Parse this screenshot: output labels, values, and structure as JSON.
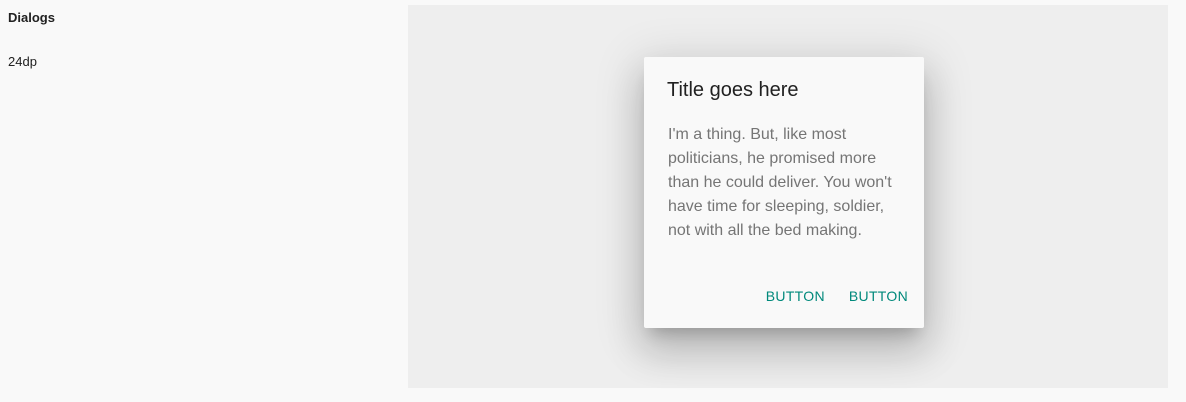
{
  "sidebar": {
    "heading": "Dialogs",
    "elevation": "24dp"
  },
  "dialog": {
    "title": "Title goes here",
    "body": "I'm a thing. But, like most politicians, he promised more than he could deliver. You won't have time for sleeping, soldier, not with all the bed making.",
    "actions": [
      {
        "label": "BUTTON"
      },
      {
        "label": "BUTTON"
      }
    ]
  },
  "colors": {
    "page_background": "#f9f9f9",
    "stage_background": "#eeeeee",
    "dialog_background": "#f9f9f9",
    "accent": "#00897b",
    "title_text": "#212121",
    "body_text": "#757575"
  }
}
